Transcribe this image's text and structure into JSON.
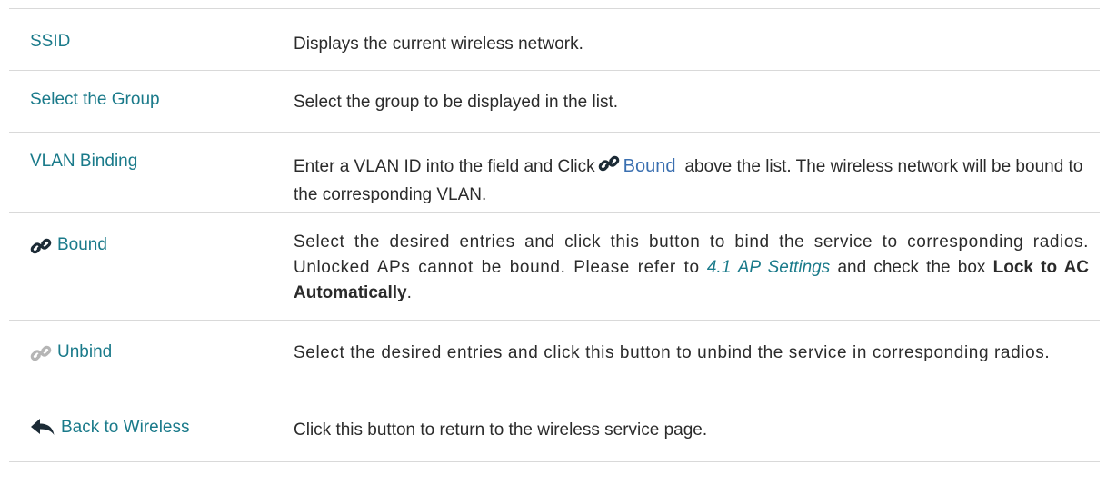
{
  "rows": [
    {
      "term": "SSID",
      "desc": "Displays the current wireless network."
    },
    {
      "term": "Select the Group",
      "desc": "Select the group to be displayed in the list."
    },
    {
      "term": "VLAN Binding",
      "desc_part1": "Enter a VLAN ID into the field and Click",
      "inline_button": "Bound",
      "desc_part2": "above the list. The wireless network will be bound to the corresponding VLAN."
    },
    {
      "term": "Bound",
      "icon": "link-icon",
      "desc_part1": "Select the desired entries and click this button to bind the service to corresponding radios. Unlocked APs cannot be bound. Please refer to",
      "desc_link": "4.1 AP Settings",
      "desc_part2": "and check the box",
      "desc_strong": "Lock to AC Automatically",
      "desc_part3": "."
    },
    {
      "term": "Unbind",
      "icon": "unlink-icon",
      "desc": "Select the desired entries and click this button to unbind the service in corresponding radios."
    },
    {
      "term": "Back to Wireless",
      "icon": "back-arrow-icon",
      "desc": "Click this button to return to the wireless service page."
    }
  ],
  "colors": {
    "term": "#1a7a8a",
    "text": "#2b2b2b",
    "border": "#d9d9d9",
    "icon_dark": "#1c2b36",
    "icon_light": "#b5b5b5",
    "bound_button_text": "#3a6fb0"
  }
}
